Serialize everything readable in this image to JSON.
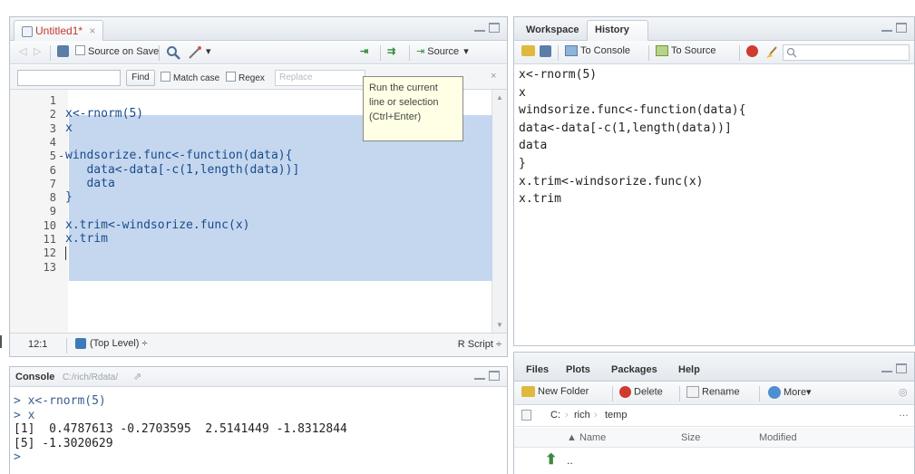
{
  "source_pane": {
    "tab_label": "Untitled1*",
    "tab_close": "×",
    "toolbar": {
      "source_on_save": "Source on Save",
      "wand_caret": "▾",
      "source_label": "Source",
      "source_caret": "▾"
    },
    "findbar": {
      "find_label": "Find",
      "match_case": "Match case",
      "regex": "Regex",
      "replace_placeholder": "Replace",
      "close": "×"
    },
    "tooltip": [
      "Run the current",
      "line or selection",
      "(Ctrl+Enter)"
    ],
    "line_numbers": [
      "1",
      "2",
      "3",
      "4",
      "5",
      "6",
      "7",
      "8",
      "9",
      "10",
      "11",
      "12",
      "13"
    ],
    "code_lines": [
      "",
      "x<-rnorm(5)",
      "x",
      "",
      "windsorize.func<-function(data){",
      "   data<-data[-c(1,length(data))]",
      "   data",
      "}",
      "",
      "x.trim<-windsorize.func(x)",
      "x.trim",
      "",
      ""
    ],
    "status": {
      "position": "12:1",
      "scope": "(Top Level) ÷",
      "file_type": "R Script ÷"
    }
  },
  "workspace_pane": {
    "tabs": [
      "Workspace",
      "History"
    ],
    "toolbar": {
      "to_console": "To Console",
      "to_source": "To Source"
    },
    "history_lines": [
      "x<-rnorm(5)",
      "x",
      "windsorize.func<-function(data){",
      "data<-data[-c(1,length(data))]",
      "data",
      "}",
      "x.trim<-windsorize.func(x)",
      "x.trim"
    ]
  },
  "console_pane": {
    "title": "Console",
    "path": "C:/rich/Rdata/",
    "lines": [
      "> x<-rnorm(5)",
      "> x",
      "[1]  0.4787613 -0.2703595  2.5141449 -1.8312844",
      "[5] -1.3020629",
      ">"
    ]
  },
  "files_pane": {
    "tabs": [
      "Files",
      "Plots",
      "Packages",
      "Help"
    ],
    "toolbar": {
      "new_folder": "New Folder",
      "delete": "Delete",
      "rename": "Rename",
      "more": "More▾"
    },
    "breadcrumb": [
      "C:",
      "rich",
      "temp"
    ],
    "columns": [
      "▲ Name",
      "Size",
      "Modified"
    ],
    "up_row": ".."
  },
  "colors": {
    "selection": "#c4d7ee",
    "code": "#1a4b8c",
    "tab_modified": "#c0392b"
  }
}
